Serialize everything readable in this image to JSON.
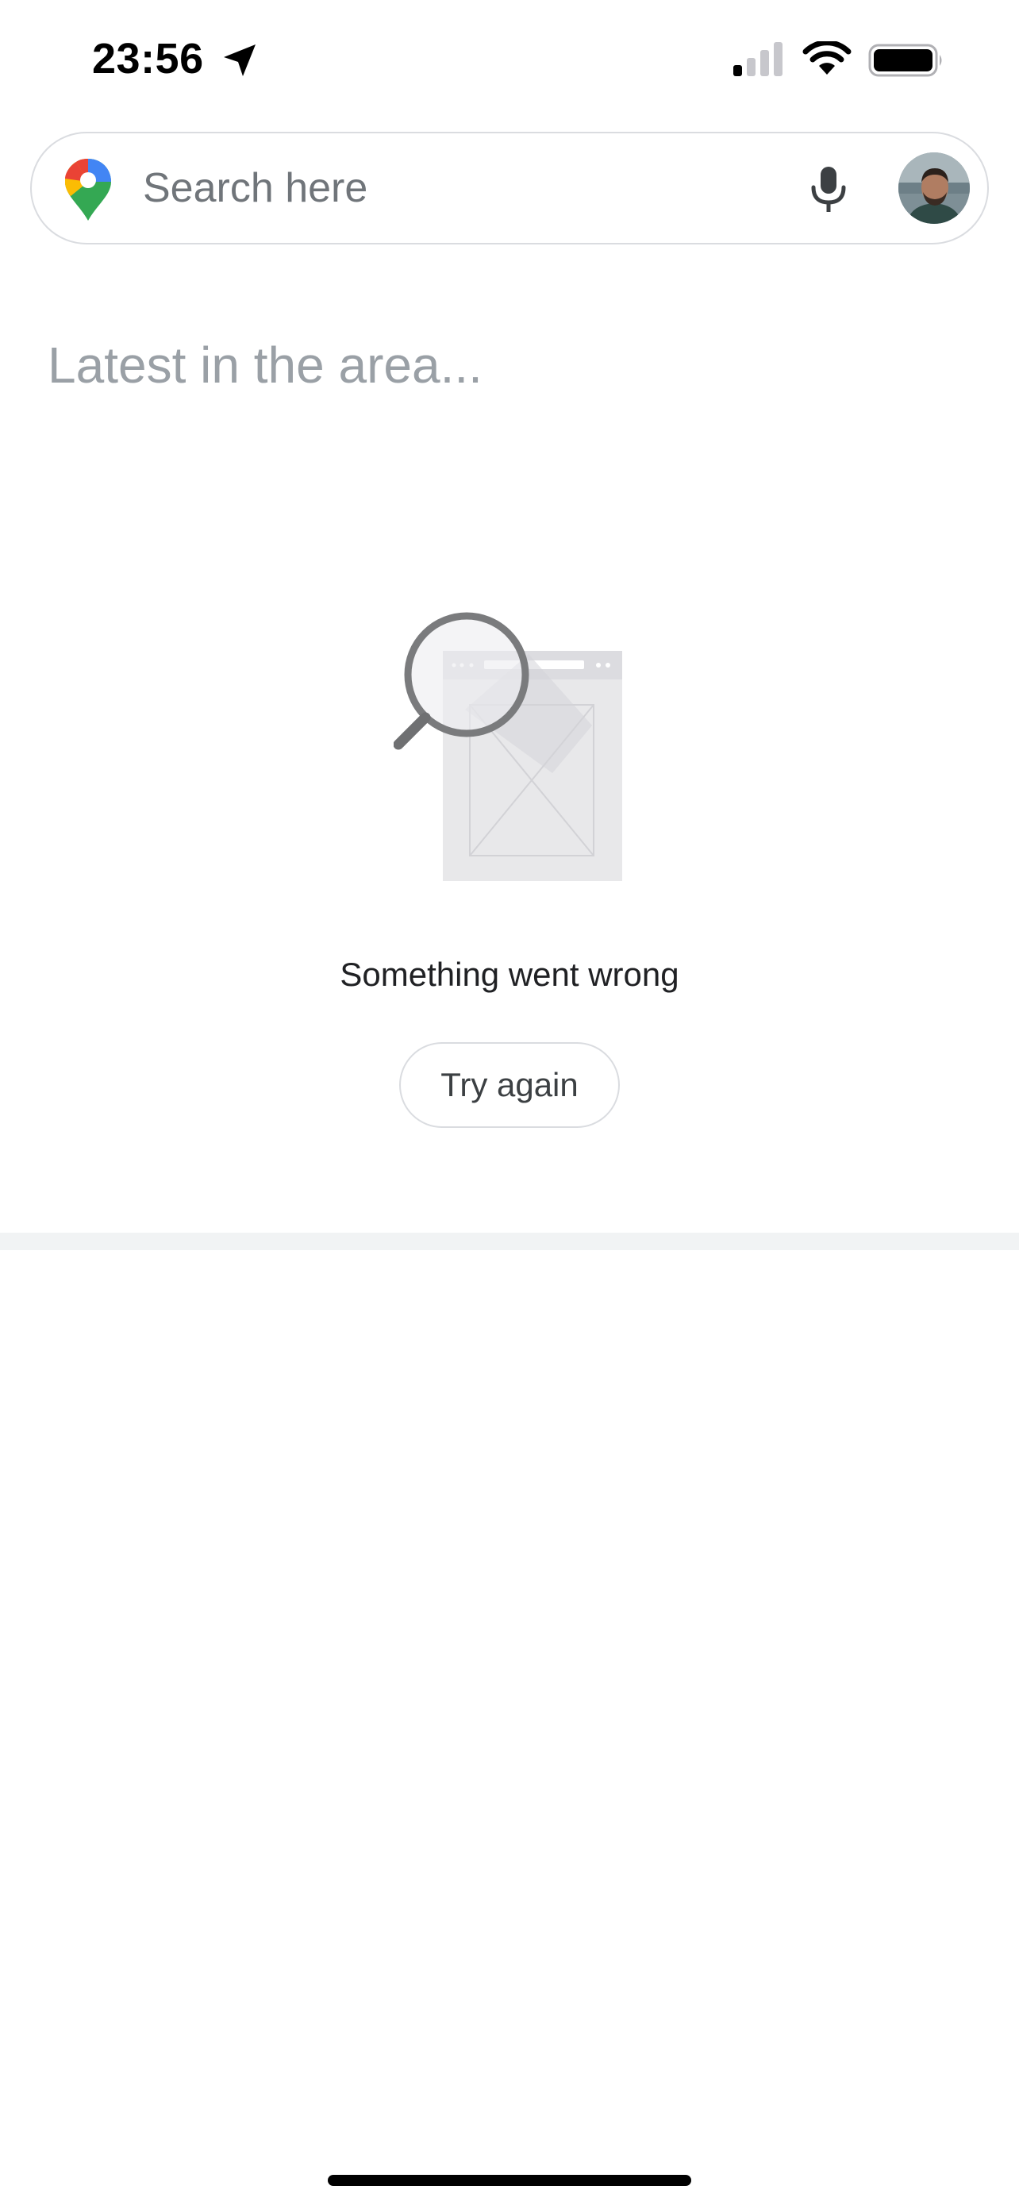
{
  "status_bar": {
    "time": "23:56",
    "icons": [
      "location-arrow-icon",
      "cellular-signal-icon",
      "wifi-icon",
      "battery-icon"
    ]
  },
  "search": {
    "placeholder": "Search here",
    "icons": {
      "logo": "google-maps-pin-icon",
      "voice": "microphone-icon",
      "account": "user-avatar"
    },
    "colors": {
      "pin_red": "#ea4335",
      "pin_yellow": "#fbbc04",
      "pin_green": "#34a853",
      "pin_blue": "#4285f4"
    }
  },
  "feed": {
    "title": "Latest in the area...",
    "error": {
      "illustration": "magnifier-over-broken-page-icon",
      "message": "Something went wrong",
      "retry_label": "Try again"
    }
  },
  "theme": {
    "divider_color": "#f1f3f4",
    "muted_text": "#9aa0a6",
    "border": "#dadce0"
  }
}
